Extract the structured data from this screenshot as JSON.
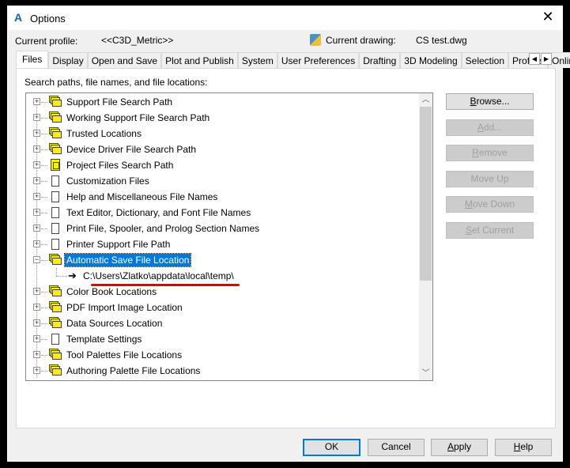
{
  "window": {
    "title": "Options",
    "close_icon": "close-icon",
    "app_icon": "autocad-logo-icon"
  },
  "profile": {
    "label": "Current profile:",
    "value": "<<C3D_Metric>>",
    "drawing_label": "Current drawing:",
    "drawing_value": "CS test.dwg"
  },
  "tabs": [
    "Files",
    "Display",
    "Open and Save",
    "Plot and Publish",
    "System",
    "User Preferences",
    "Drafting",
    "3D Modeling",
    "Selection",
    "Profiles",
    "Online"
  ],
  "active_tab": "Files",
  "files": {
    "section_label": "Search paths, file names, and file locations:",
    "tree": [
      {
        "label": "Support File Search Path",
        "icon": "folders"
      },
      {
        "label": "Working Support File Search Path",
        "icon": "folders"
      },
      {
        "label": "Trusted Locations",
        "icon": "folders"
      },
      {
        "label": "Device Driver File Search Path",
        "icon": "folders"
      },
      {
        "label": "Project Files Search Path",
        "icon": "project"
      },
      {
        "label": "Customization Files",
        "icon": "document"
      },
      {
        "label": "Help and Miscellaneous File Names",
        "icon": "document"
      },
      {
        "label": "Text Editor, Dictionary, and Font File Names",
        "icon": "document"
      },
      {
        "label": "Print File, Spooler, and Prolog Section Names",
        "icon": "document"
      },
      {
        "label": "Printer Support File Path",
        "icon": "document"
      },
      {
        "label": "Automatic Save File Location",
        "icon": "folders-open",
        "expanded": true,
        "selected": true,
        "children": [
          "C:\\Users\\Zlatko\\appdata\\local\\temp\\"
        ]
      },
      {
        "label": "Color Book Locations",
        "icon": "folders"
      },
      {
        "label": "PDF Import Image Location",
        "icon": "folders"
      },
      {
        "label": "Data Sources Location",
        "icon": "folders"
      },
      {
        "label": "Template Settings",
        "icon": "document"
      },
      {
        "label": "Tool Palettes File Locations",
        "icon": "folders"
      },
      {
        "label": "Authoring Palette File Locations",
        "icon": "folders"
      }
    ],
    "buttons": [
      {
        "label": "Browse...",
        "enabled": true
      },
      {
        "label": "Add...",
        "enabled": false
      },
      {
        "label": "Remove",
        "enabled": false
      },
      {
        "label": "Move Up",
        "enabled": false
      },
      {
        "label": "Move Down",
        "enabled": false
      },
      {
        "label": "Set Current",
        "enabled": false
      }
    ]
  },
  "footer": {
    "ok": "OK",
    "cancel": "Cancel",
    "apply": "Apply",
    "help": "Help"
  },
  "colors": {
    "selection": "#0078d7",
    "annotation_underline": "#e00000"
  }
}
